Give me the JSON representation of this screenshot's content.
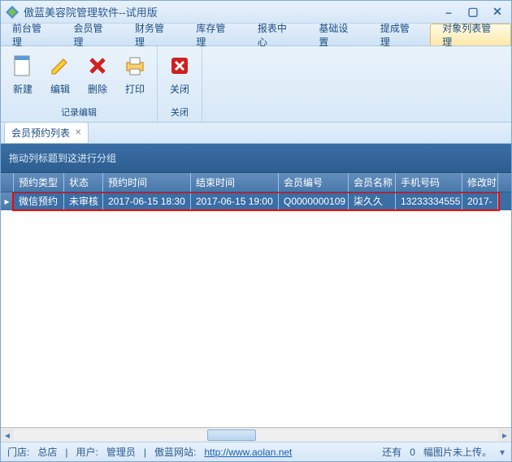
{
  "window": {
    "title": "傲蓝美容院管理软件--试用版"
  },
  "menu": {
    "items": [
      "前台管理",
      "会员管理",
      "财务管理",
      "库存管理",
      "报表中心",
      "基础设置",
      "提成管理",
      "对象列表管理"
    ],
    "active_index": 7
  },
  "toolbar": {
    "groups": {
      "edit": {
        "label": "记录编辑",
        "buttons": {
          "new": "新建",
          "editBtn": "编辑",
          "delete": "删除",
          "print": "打印"
        }
      },
      "close": {
        "label": "关闭",
        "buttons": {
          "closeBtn": "关闭"
        }
      }
    }
  },
  "tabs": {
    "doc1": "会员预约列表"
  },
  "grid": {
    "group_hint": "拖动列标题到这进行分组",
    "columns": {
      "type": "预约类型",
      "status": "状态",
      "start": "预约时间",
      "end": "结束时间",
      "memno": "会员编号",
      "memname": "会员名称",
      "phone": "手机号码",
      "mod": "修改时"
    },
    "rows": [
      {
        "type": "微信预约",
        "status": "未审核",
        "start": "2017-06-15 18:30",
        "end": "2017-06-15 19:00",
        "memno": "Q0000000109",
        "memname": "柒久久",
        "phone": "13233334555",
        "mod": "2017-"
      }
    ]
  },
  "status": {
    "store_label": "门店:",
    "store_value": "总店",
    "user_label": "用户:",
    "user_value": "管理员",
    "site_label": "傲蓝网站:",
    "site_url": "http://www.aolan.net",
    "upload_prefix": "还有",
    "upload_count": "0",
    "upload_suffix": "幅图片未上传。"
  }
}
